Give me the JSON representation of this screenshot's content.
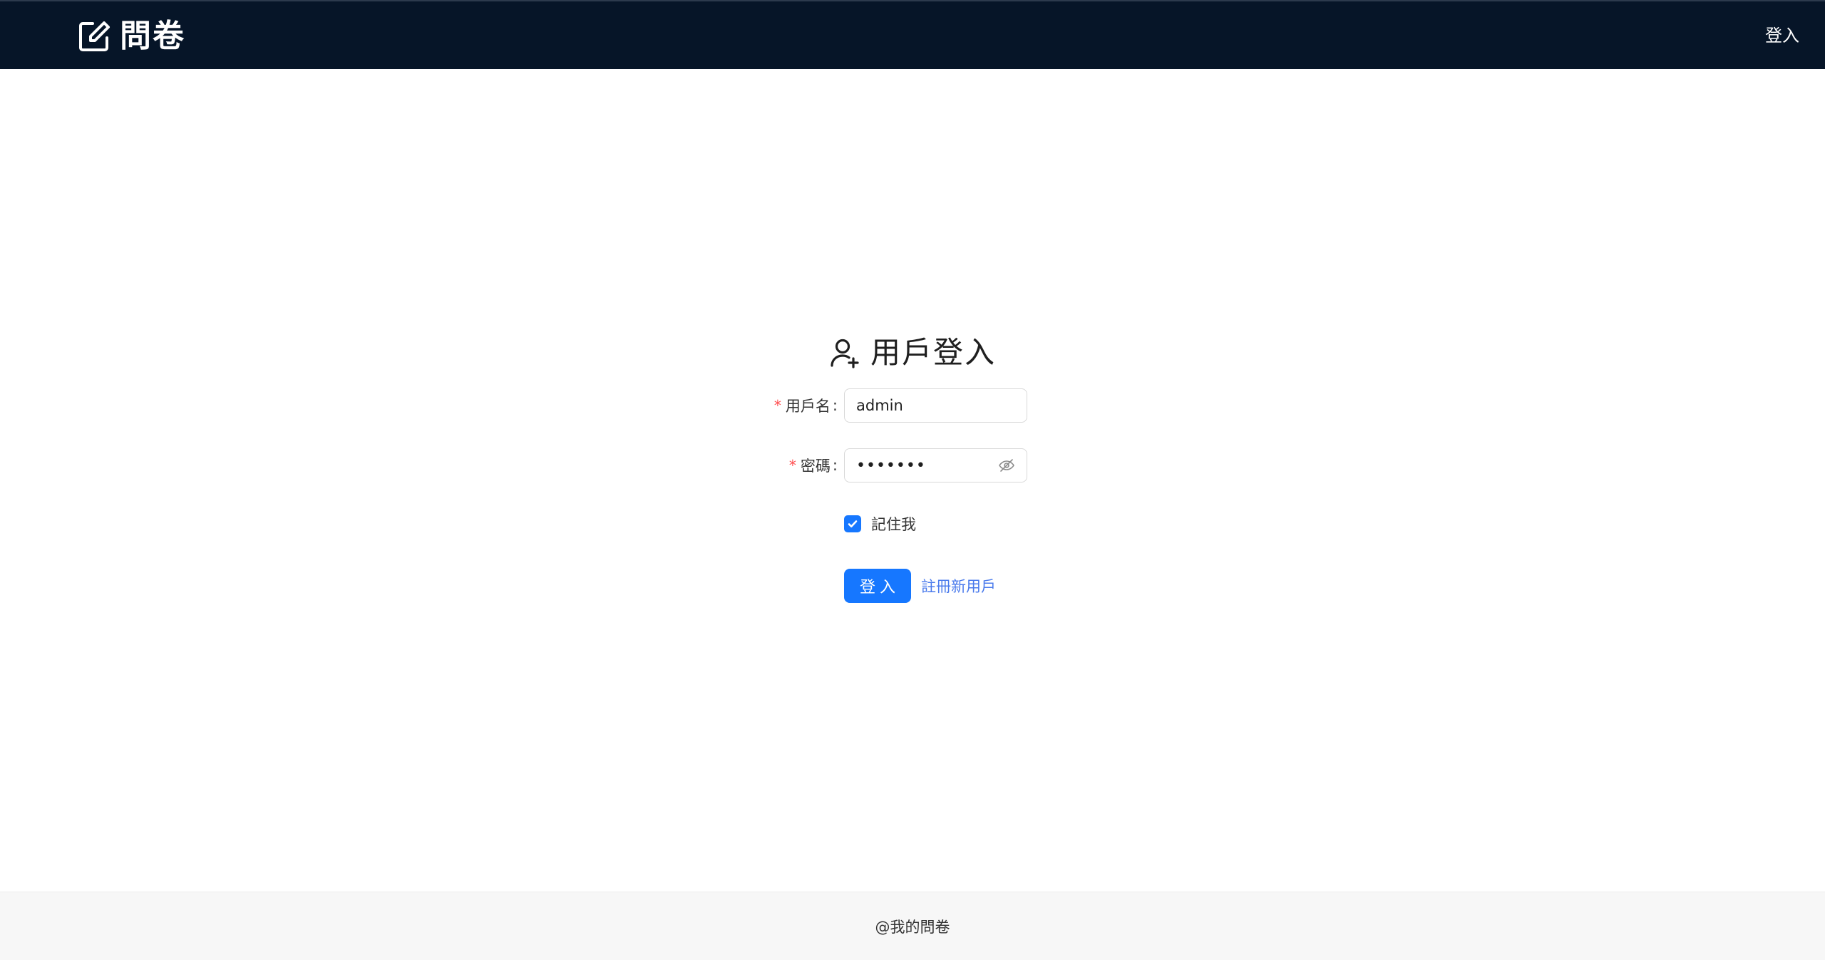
{
  "header": {
    "logo_text": "問卷",
    "login_link": "登入"
  },
  "login": {
    "title": "用戶登入",
    "username": {
      "label": "用戶名",
      "value": "admin"
    },
    "password": {
      "label": "密碼",
      "value": "•••••••"
    },
    "remember": {
      "label": "記住我",
      "checked": true
    },
    "submit_label": "登入",
    "register_link": "註冊新用戶"
  },
  "footer": {
    "text": "@我的問卷"
  },
  "colors": {
    "header_bg": "#061528",
    "primary": "#1677ff",
    "link": "#4b7bec",
    "required": "#ff4d4f"
  }
}
